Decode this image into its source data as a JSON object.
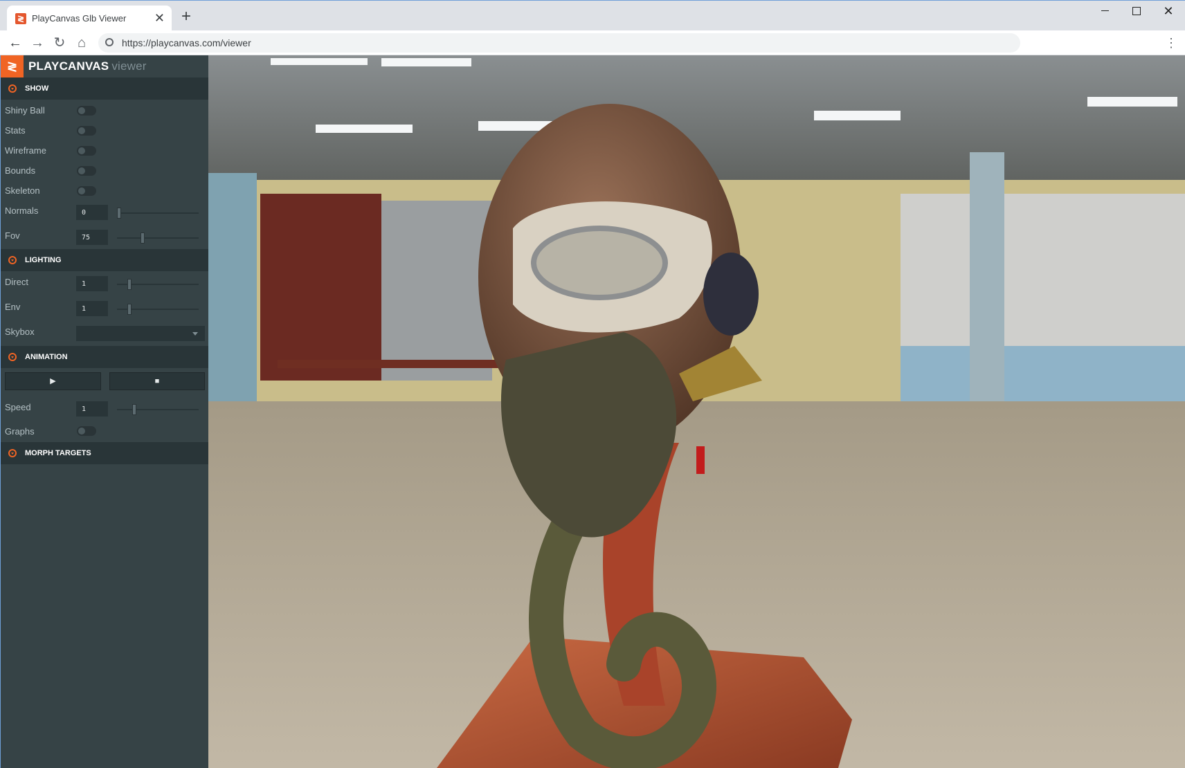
{
  "browser": {
    "tab_title": "PlayCanvas Glb Viewer",
    "tab_close": "✕",
    "new_tab": "+",
    "url": "https://playcanvas.com/viewer",
    "window_controls": {
      "minimize": "",
      "maximize": "",
      "close": "✕"
    },
    "nav": {
      "back": "←",
      "forward": "→",
      "reload": "↻",
      "home": "⌂",
      "menu": "⋮"
    }
  },
  "app": {
    "logo_glyph": "≷",
    "title_main": "PLAYCANVAS",
    "title_sub": "viewer"
  },
  "sections": {
    "show": {
      "title": "SHOW",
      "shiny_ball": "Shiny Ball",
      "stats": "Stats",
      "wireframe": "Wireframe",
      "bounds": "Bounds",
      "skeleton": "Skeleton",
      "normals_label": "Normals",
      "normals_value": "0",
      "normals_slider_fraction": 0.0,
      "fov_label": "Fov",
      "fov_value": "75",
      "fov_slider_fraction": 0.3
    },
    "lighting": {
      "title": "LIGHTING",
      "direct_label": "Direct",
      "direct_value": "1",
      "direct_slider_fraction": 0.13,
      "env_label": "Env",
      "env_value": "1",
      "env_slider_fraction": 0.13,
      "skybox_label": "Skybox",
      "skybox_value": ""
    },
    "animation": {
      "title": "ANIMATION",
      "play": "▶",
      "stop": "■",
      "speed_label": "Speed",
      "speed_value": "1",
      "speed_slider_fraction": 0.2,
      "graphs": "Graphs"
    },
    "morph_targets": {
      "title": "MORPH TARGETS"
    }
  },
  "colors": {
    "accent": "#f06424",
    "panel_bg": "#364346",
    "section_bg": "#293538"
  }
}
